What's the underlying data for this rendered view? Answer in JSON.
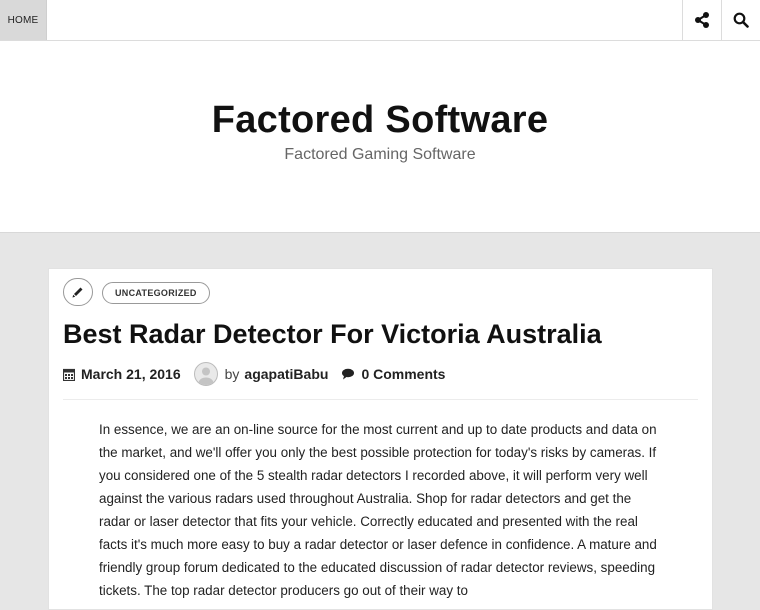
{
  "nav": {
    "home_label": "HOME",
    "share_icon": "share-icon",
    "search_icon": "search-icon"
  },
  "site": {
    "title": "Factored Software",
    "tagline": "Factored Gaming Software"
  },
  "post": {
    "format_icon": "pencil-icon",
    "category": "UNCATEGORIZED",
    "title": "Best Radar Detector For Victoria Australia",
    "date": "March 21, 2016",
    "by_label": "by",
    "author": "agapatiBabu",
    "comments": "0 Comments",
    "body": "In essence, we are an on-line source for the most current and up to date products and data on the market, and we'll offer you only the best possible protection for today's risks by cameras. If you considered one of the 5 stealth radar detectors I recorded above, it will perform very well against the various radars used throughout Australia. Shop for radar detectors and get the radar or laser detector that fits your vehicle. Correctly educated and presented with the real facts it's much more easy to buy a radar detector or laser defence in confidence. A mature and friendly group forum dedicated to the educated discussion of radar detector reviews, speeding tickets. The top radar detector producers go out of their way to"
  },
  "colors": {
    "page_bg": "#e6e6e6",
    "header_bg": "#ffffff",
    "home_bg": "#d9d9d9",
    "text": "#111111",
    "tagline": "#666666"
  }
}
